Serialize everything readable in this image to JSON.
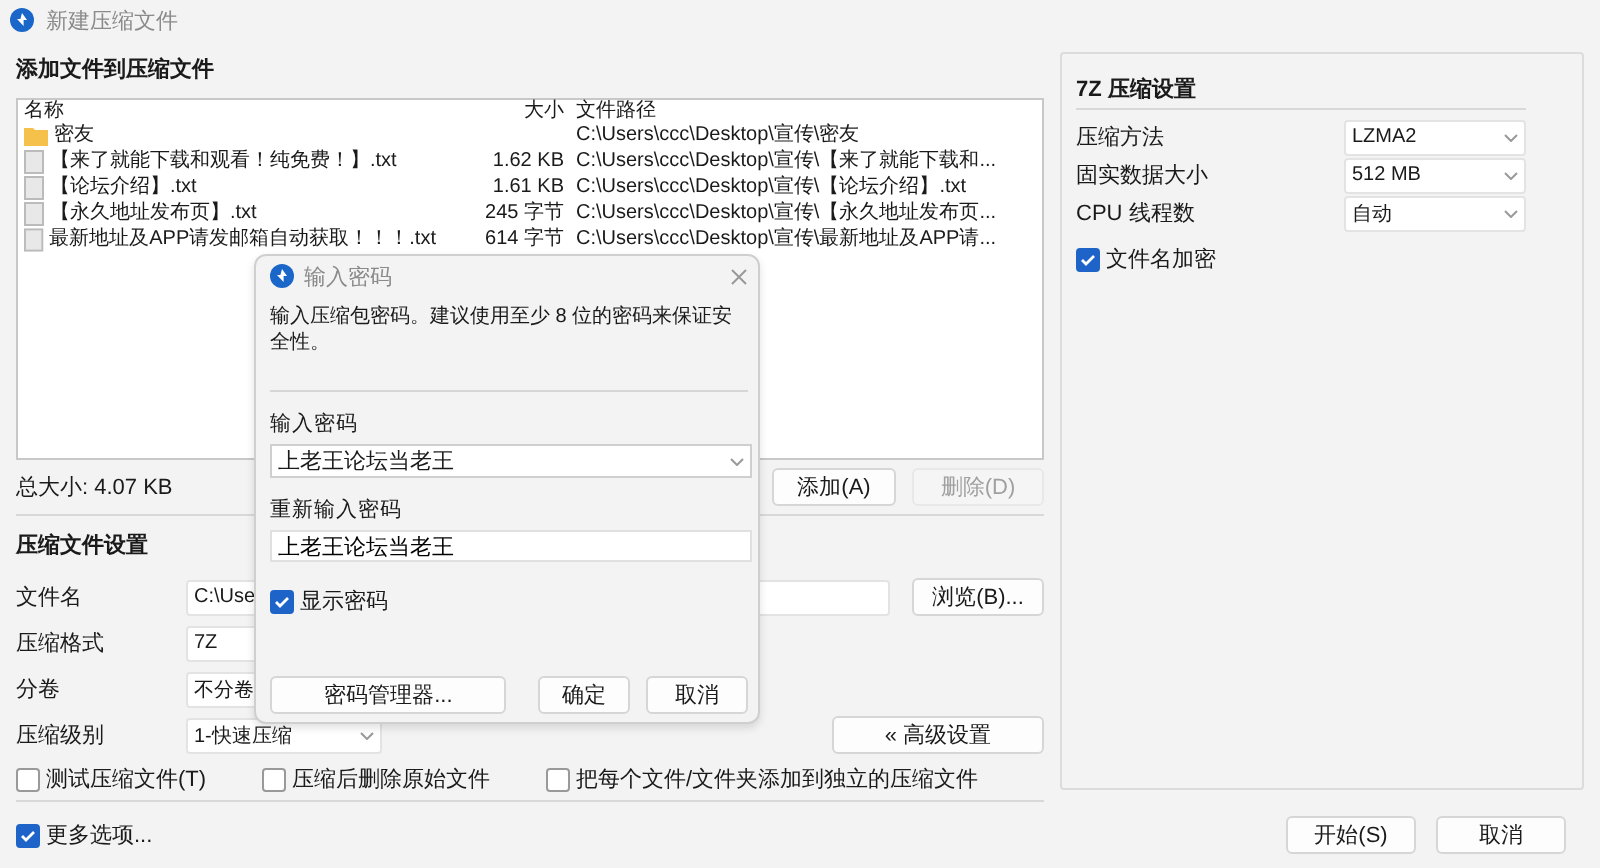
{
  "window": {
    "title": "新建压缩文件"
  },
  "files_section": {
    "title": "添加文件到压缩文件",
    "columns": [
      "名称",
      "大小",
      "文件路径"
    ],
    "rows": [
      {
        "kind": "folder",
        "name": "密友",
        "size": "",
        "path": "C:\\Users\\ccc\\Desktop\\宣传\\密友"
      },
      {
        "kind": "file",
        "name": "【来了就能下载和观看！纯免费！】.txt",
        "size": "1.62 KB",
        "path": "C:\\Users\\ccc\\Desktop\\宣传\\【来了就能下载和..."
      },
      {
        "kind": "file",
        "name": "【论坛介绍】.txt",
        "size": "1.61 KB",
        "path": "C:\\Users\\ccc\\Desktop\\宣传\\【论坛介绍】.txt"
      },
      {
        "kind": "file",
        "name": "【永久地址发布页】.txt",
        "size": "245 字节",
        "path": "C:\\Users\\ccc\\Desktop\\宣传\\【永久地址发布页..."
      },
      {
        "kind": "file",
        "name": "最新地址及APP请发邮箱自动获取！！！.txt",
        "size": "614 字节",
        "path": "C:\\Users\\ccc\\Desktop\\宣传\\最新地址及APP请..."
      }
    ],
    "total": "总大小: 4.07 KB",
    "buttons": [
      {
        "label": "添加(A)",
        "disabled": false
      },
      {
        "label": "删除(D)",
        "disabled": true
      }
    ]
  },
  "archive_settings": {
    "title": "压缩文件设置",
    "filename": {
      "label": "文件名",
      "value": "C:\\Use",
      "button": "浏览(B)..."
    },
    "format": {
      "label": "压缩格式",
      "value": "7Z"
    },
    "volume": {
      "label": "分卷",
      "value": "不分卷"
    },
    "level": {
      "label": "压缩级别",
      "value": "1-快速压缩"
    },
    "advanced_button": "« 高级设置",
    "options": [
      {
        "label": "测试压缩文件(T)",
        "checked": false
      },
      {
        "label": "压缩后删除原始文件",
        "checked": false
      },
      {
        "label": "把每个文件/文件夹添加到独立的压缩文件",
        "checked": false
      }
    ]
  },
  "seven_z_settings": {
    "title": "7Z 压缩设置",
    "fields": [
      {
        "label": "压缩方法",
        "value": "LZMA2"
      },
      {
        "label": "固实数据大小",
        "value": "512 MB"
      },
      {
        "label": "CPU 线程数",
        "value": "自动"
      }
    ],
    "encrypt_names": {
      "label": "文件名加密",
      "checked": true
    }
  },
  "more_options": {
    "label": "更多选项...",
    "checked": true
  },
  "footer_buttons": [
    "开始(S)",
    "取消"
  ],
  "password_dialog": {
    "title": "输入密码",
    "message": "输入压缩包密码。建议使用至少 8 位的密码来保证安全性。",
    "password_label": "输入密码",
    "password": "上老王论坛当老王",
    "confirm_label": "重新输入密码",
    "confirm": "上老王论坛当老王",
    "show_password": {
      "label": "显示密码",
      "checked": true
    },
    "buttons": [
      "密码管理器...",
      "确定",
      "取消"
    ]
  }
}
